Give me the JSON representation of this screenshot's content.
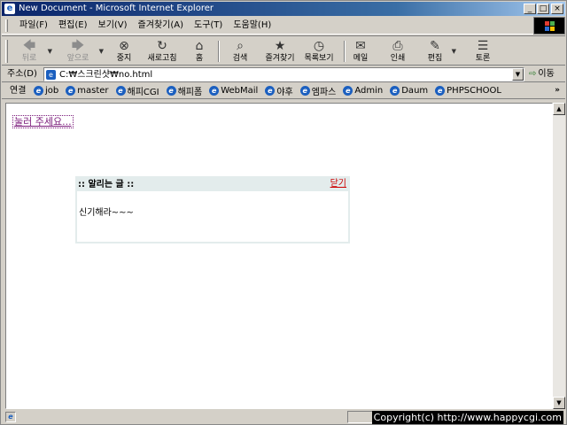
{
  "window": {
    "title": "New Document - Microsoft Internet Explorer",
    "buttons": [
      "_",
      "□",
      "×"
    ]
  },
  "menu": {
    "items": [
      "파일(F)",
      "편집(E)",
      "보기(V)",
      "즐겨찾기(A)",
      "도구(T)",
      "도움말(H)"
    ]
  },
  "toolbar": {
    "buttons": [
      {
        "label": "뒤로",
        "icon": "back-arrow-icon",
        "glyph": "🡄",
        "enabled": false
      },
      {
        "label": "앞으로",
        "icon": "forward-arrow-icon",
        "glyph": "🡆",
        "enabled": false
      },
      {
        "label": "중지",
        "icon": "stop-icon",
        "glyph": "⊗",
        "enabled": true
      },
      {
        "label": "새로고침",
        "icon": "refresh-icon",
        "glyph": "↻",
        "enabled": true
      },
      {
        "label": "홈",
        "icon": "home-icon",
        "glyph": "⌂",
        "enabled": true
      },
      {
        "label": "검색",
        "icon": "search-icon",
        "glyph": "⌕",
        "enabled": true
      },
      {
        "label": "즐겨찾기",
        "icon": "favorites-icon",
        "glyph": "★",
        "enabled": true
      },
      {
        "label": "목록보기",
        "icon": "history-icon",
        "glyph": "◷",
        "enabled": true
      },
      {
        "label": "메일",
        "icon": "mail-icon",
        "glyph": "✉",
        "enabled": true
      },
      {
        "label": "인쇄",
        "icon": "print-icon",
        "glyph": "⎙",
        "enabled": true
      },
      {
        "label": "편집",
        "icon": "edit-icon",
        "glyph": "✎",
        "enabled": true
      },
      {
        "label": "토론",
        "icon": "discuss-icon",
        "glyph": "☰",
        "enabled": true
      }
    ]
  },
  "address": {
    "label": "주소(D)",
    "value": "C:₩스크린샷₩no.html",
    "go_label": "이동"
  },
  "links": {
    "label": "연결",
    "items": [
      "job",
      "master",
      "해피CGI",
      "해피폼",
      "WebMail",
      "야후",
      "엠파스",
      "Admin",
      "Daum",
      "PHPSCHOOL"
    ],
    "more": "»"
  },
  "page": {
    "press_link": "눌러 주세요...",
    "popup": {
      "title": ":: 알리는 글 ::",
      "close": "닫기",
      "body": "신기해라~~~"
    }
  },
  "status": {
    "copyright": "Copyright(c) http://www.happycgi.com"
  },
  "colors": {
    "titlebar_start": "#0a246a",
    "titlebar_end": "#a6caf0",
    "chrome": "#d4d0c8",
    "visited_link": "#7a1a7a",
    "close_link": "#cc0000",
    "popup_header": "#e3ecec"
  }
}
